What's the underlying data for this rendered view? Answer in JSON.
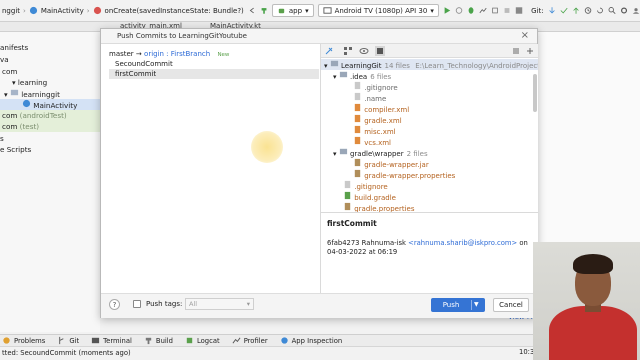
{
  "ide": {
    "breadcrumbs": [
      "nggit",
      "MainActivity",
      "onCreate(savedInstanceState: Bundle?)"
    ],
    "run_config": "app",
    "device": "Android TV (1080p) API 30",
    "git_label": "Git:",
    "tabs": [
      "activity_main.xml",
      "MainActivity.kt"
    ],
    "tree": [
      {
        "text": "anifests",
        "indent": 0,
        "style": ""
      },
      {
        "text": "va",
        "indent": 0,
        "style": ""
      },
      {
        "text": "com",
        "indent": 0,
        "style": ""
      },
      {
        "text": "learning",
        "indent": 1,
        "style": ""
      },
      {
        "text": "learninggit",
        "indent": 2,
        "style": ""
      },
      {
        "text": "MainActivity",
        "indent": 3,
        "style": "sel"
      },
      {
        "text": "com",
        "suffix": "(androidTest)",
        "indent": 0,
        "style": "green"
      },
      {
        "text": "com",
        "suffix": "(test)",
        "indent": 0,
        "style": "green"
      },
      {
        "text": "s",
        "indent": 0,
        "style": ""
      },
      {
        "text": "e Scripts",
        "indent": 0,
        "style": ""
      }
    ],
    "bottom_tools": [
      "Problems",
      "Git",
      "Terminal",
      "Build",
      "Logcat",
      "Profiler",
      "App Inspection"
    ],
    "status_text": "tted: SecoundCommit (moments ago)",
    "status_time": "10:3",
    "view_file": "View Fil"
  },
  "dialog": {
    "title": "Push Commits to LearningGitYoutube",
    "close_label": "×",
    "branch_local": "master",
    "arrow": "→",
    "branch_remote": "origin : FirstBranch",
    "new_badge": "New",
    "commits": [
      "SecoundCommit",
      "firstCommit"
    ],
    "selected_commit_index": 1,
    "files": [
      {
        "name": "LearningGit",
        "count": "14 files",
        "path": "E:\\Learn_Technology\\AndroidProject\\LearningGit",
        "level": 0,
        "kind": "root"
      },
      {
        "name": ".idea",
        "count": "6 files",
        "level": 1,
        "kind": "folder"
      },
      {
        "name": ".gitignore",
        "level": 2,
        "kind": "file"
      },
      {
        "name": ".name",
        "level": 2,
        "kind": "file"
      },
      {
        "name": "compiler.xml",
        "level": 2,
        "kind": "xml"
      },
      {
        "name": "gradle.xml",
        "level": 2,
        "kind": "xml"
      },
      {
        "name": "misc.xml",
        "level": 2,
        "kind": "xml"
      },
      {
        "name": "vcs.xml",
        "level": 2,
        "kind": "xml"
      },
      {
        "name": "gradle\\wrapper",
        "count": "2 files",
        "level": 1,
        "kind": "folder"
      },
      {
        "name": "gradle-wrapper.jar",
        "level": 2,
        "kind": "xml"
      },
      {
        "name": "gradle-wrapper.properties",
        "level": 2,
        "kind": "xml"
      },
      {
        "name": ".gitignore",
        "level": 1,
        "kind": "file"
      },
      {
        "name": "build.gradle",
        "level": 1,
        "kind": "xml"
      },
      {
        "name": "gradle.properties",
        "level": 1,
        "kind": "xml"
      }
    ],
    "detail": {
      "title": "firstCommit",
      "hash": "6fab4273",
      "author": "Rahnuma-isk",
      "email": "<rahnuma.sharib@iskpro.com>",
      "on": "on",
      "date": "04-03-2022 at 06:19"
    },
    "help_label": "?",
    "push_tags_label": "Push tags:",
    "push_tags_value": "All",
    "push_label": "Push",
    "cancel_label": "Cancel"
  },
  "colors": {
    "accent": "#3574d4",
    "link": "#2d6bd6",
    "new_badge": "#5aa04b",
    "xml_file": "#b4621f"
  }
}
